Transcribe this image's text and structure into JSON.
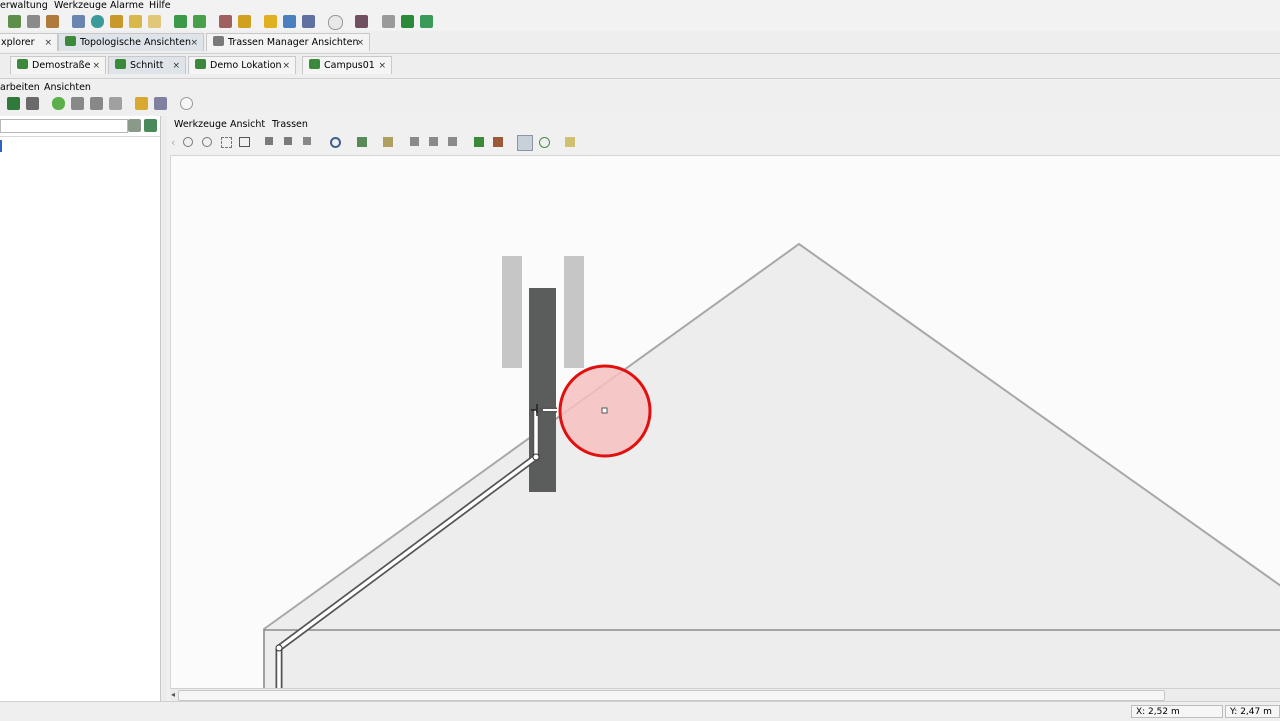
{
  "menubar": {
    "items": [
      "erwaltung",
      "Werkzeuge",
      "Alarme",
      "Hilfe"
    ]
  },
  "main_tabs": [
    {
      "label": "xplorer"
    },
    {
      "label": "Topologische Ansichten"
    },
    {
      "label": "Trassen Manager Ansichten"
    }
  ],
  "doc_tabs": [
    {
      "label": "Demostraße"
    },
    {
      "label": "Schnitt"
    },
    {
      "label": "Demo Lokation"
    },
    {
      "label": "Campus01"
    }
  ],
  "submenu": {
    "items": [
      "arbeiten",
      "Ansichten"
    ]
  },
  "view_menu": {
    "items": [
      "Werkzeuge",
      "Ansicht",
      "Trassen"
    ]
  },
  "tab_close_glyph": "×",
  "status": {
    "x": "X: 2,52 m",
    "y": "Y: 2,47 m"
  },
  "colors": {
    "highlight_circle": "#e01010",
    "highlight_fill": "#f7c0c0",
    "pole_dark": "#5a5d5b",
    "pole_light": "#c4c4c4",
    "roof_fill": "#ededed",
    "roof_edge": "#a8a8a8"
  }
}
